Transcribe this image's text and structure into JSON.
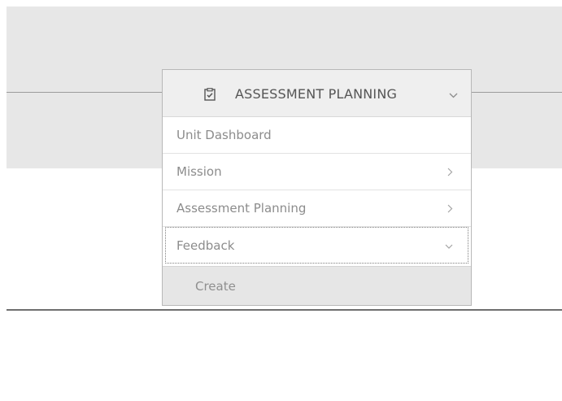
{
  "page": {
    "background_band_color": "#e7e7e7",
    "rule_color": "#9b9b9b",
    "bottom_rule_color": "#6f6f6f"
  },
  "dropdown": {
    "title": "ASSESSMENT PLANNING",
    "icon": "clipboard-check-icon",
    "header_chevron": "chevron-down-icon",
    "items": [
      {
        "label": "Unit Dashboard",
        "icon": ""
      },
      {
        "label": "Mission",
        "icon": "chevron-right-icon"
      },
      {
        "label": "Assessment Planning",
        "icon": "chevron-right-icon"
      },
      {
        "label": "Feedback",
        "icon": "chevron-down-icon",
        "expanded": true,
        "focused": true
      }
    ],
    "submenu": {
      "label": "Create"
    }
  }
}
